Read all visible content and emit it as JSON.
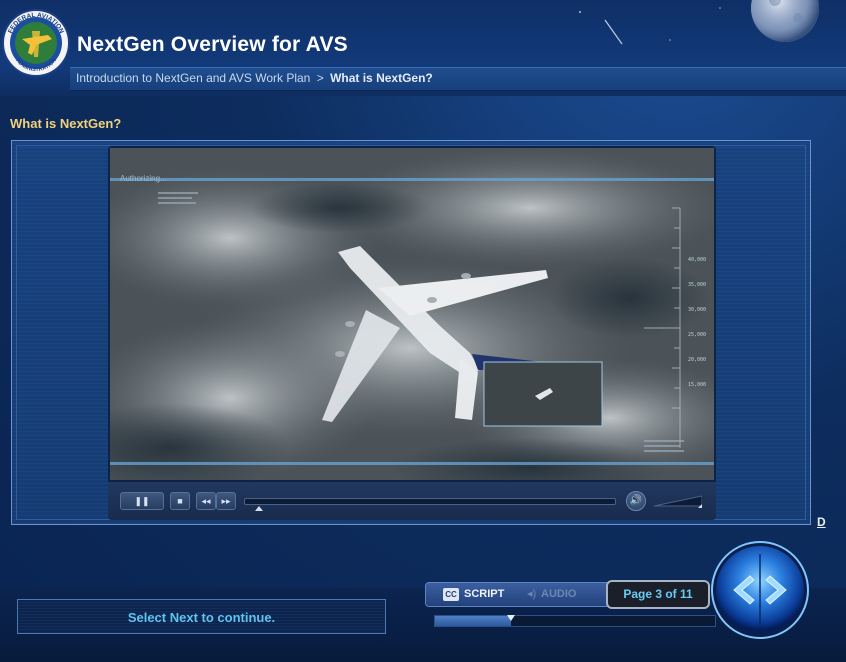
{
  "header": {
    "title": "NextGen Overview for AVS",
    "seal_text": [
      "FEDERAL AVIATION",
      "ADMINISTRATION"
    ],
    "breadcrumb": {
      "parent": "Introduction to NextGen and AVS Work Plan",
      "separator": ">",
      "current": "What is NextGen?"
    }
  },
  "page": {
    "heading": "What is NextGen?",
    "side_link": "D"
  },
  "video": {
    "overlay_text": "Authorizing...",
    "altitude_scale": [
      "40,000",
      "35,000",
      "30,000",
      "25,000",
      "20,000",
      "15,000"
    ],
    "playback_progress": 0.04,
    "controls": {
      "play_pause_icon": "pause-icon",
      "stop_icon": "stop-icon",
      "rewind_icon": "rewind-icon",
      "forward_icon": "fast-forward-icon",
      "volume_icon": "speaker-icon"
    }
  },
  "footer": {
    "status_message": "Select Next to continue.",
    "cc_badge": "CC",
    "script_label": "SCRIPT",
    "audio_label": "AUDIO",
    "page_indicator": "Page 3 of 11",
    "course_progress": 0.27,
    "nav_icons": [
      "back-arrow-icon",
      "next-arrow-icon"
    ]
  },
  "colors": {
    "heading": "#f1d27a",
    "status_text": "#5cc4ef",
    "page_indicator_text": "#66cdf5",
    "background": "#0c2a57"
  }
}
